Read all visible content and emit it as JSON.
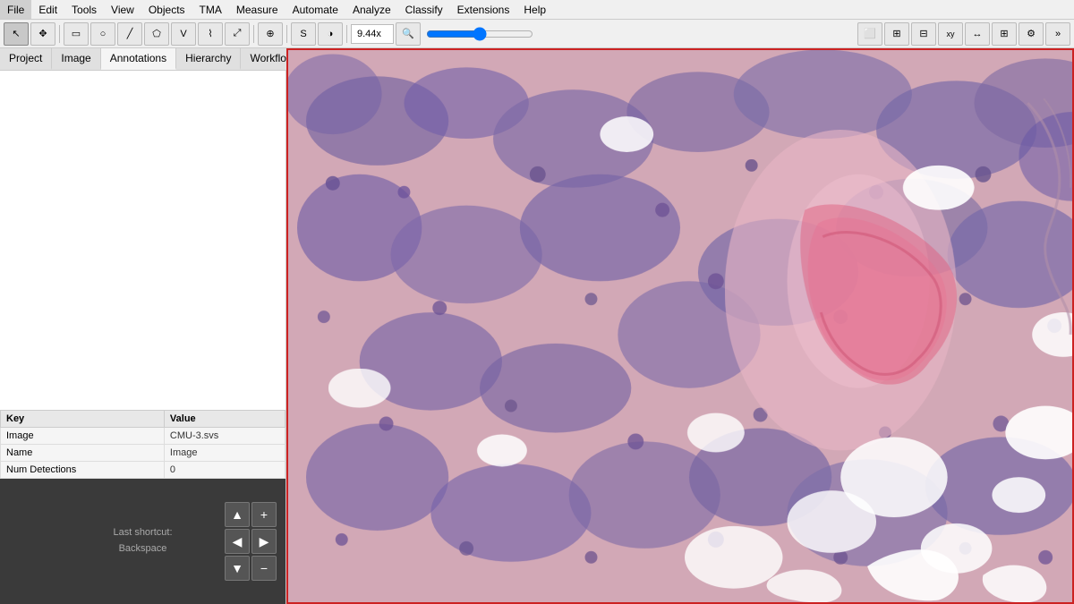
{
  "menubar": {
    "items": [
      "File",
      "Edit",
      "Tools",
      "View",
      "Objects",
      "TMA",
      "Measure",
      "Automate",
      "Analyze",
      "Classify",
      "Extensions",
      "Help"
    ]
  },
  "toolbar": {
    "tools": [
      {
        "name": "pointer-tool",
        "icon": "↖",
        "label": "Move tool"
      },
      {
        "name": "pan-tool",
        "icon": "✥",
        "label": "Pan tool"
      },
      {
        "name": "rectangle-tool",
        "icon": "▭",
        "label": "Rectangle"
      },
      {
        "name": "ellipse-tool",
        "icon": "○",
        "label": "Ellipse"
      },
      {
        "name": "line-tool",
        "icon": "/",
        "label": "Line"
      },
      {
        "name": "polygon-tool",
        "icon": "⬠",
        "label": "Polygon"
      },
      {
        "name": "wand-tool",
        "icon": "V",
        "label": "Wand"
      },
      {
        "name": "points-tool",
        "icon": "⌇",
        "label": "Points"
      },
      {
        "name": "transform-tool",
        "icon": "⤢",
        "label": "Transform"
      },
      {
        "name": "split-tool",
        "icon": "⊕",
        "label": "Split"
      },
      {
        "name": "s-tool",
        "icon": "S",
        "label": "S-tool"
      },
      {
        "name": "brightness-tool",
        "icon": "◑",
        "label": "Brightness"
      }
    ],
    "zoom_value": "9.44x",
    "zoom_icon": "🔍",
    "right_tools": [
      {
        "name": "detection-tool",
        "icon": "⬜"
      },
      {
        "name": "grid-tool",
        "icon": "⊞"
      },
      {
        "name": "mini-tool",
        "icon": "⊟"
      },
      {
        "name": "coordinates-tool",
        "icon": "xy"
      },
      {
        "name": "measure-tool",
        "icon": "↔"
      },
      {
        "name": "grid2-tool",
        "icon": "⊞"
      },
      {
        "name": "settings-tool",
        "icon": "⚙"
      },
      {
        "name": "more-tool",
        "icon": "»"
      }
    ]
  },
  "left_panel": {
    "tabs": [
      "Project",
      "Image",
      "Annotations",
      "Hierarchy",
      "Workflo..."
    ],
    "active_tab": "Annotations",
    "properties": {
      "header_key": "Key",
      "header_value": "Value",
      "rows": [
        {
          "key": "Image",
          "value": "CMU-3.svs",
          "is_link": false
        },
        {
          "key": "Name",
          "value": "Image",
          "is_link": false
        },
        {
          "key": "Num Detections",
          "value": "0",
          "is_link": false
        }
      ]
    },
    "nav": {
      "shortcut_label": "Last shortcut:",
      "shortcut_value": "Backspace"
    }
  },
  "image": {
    "border_color": "#cc2222"
  }
}
